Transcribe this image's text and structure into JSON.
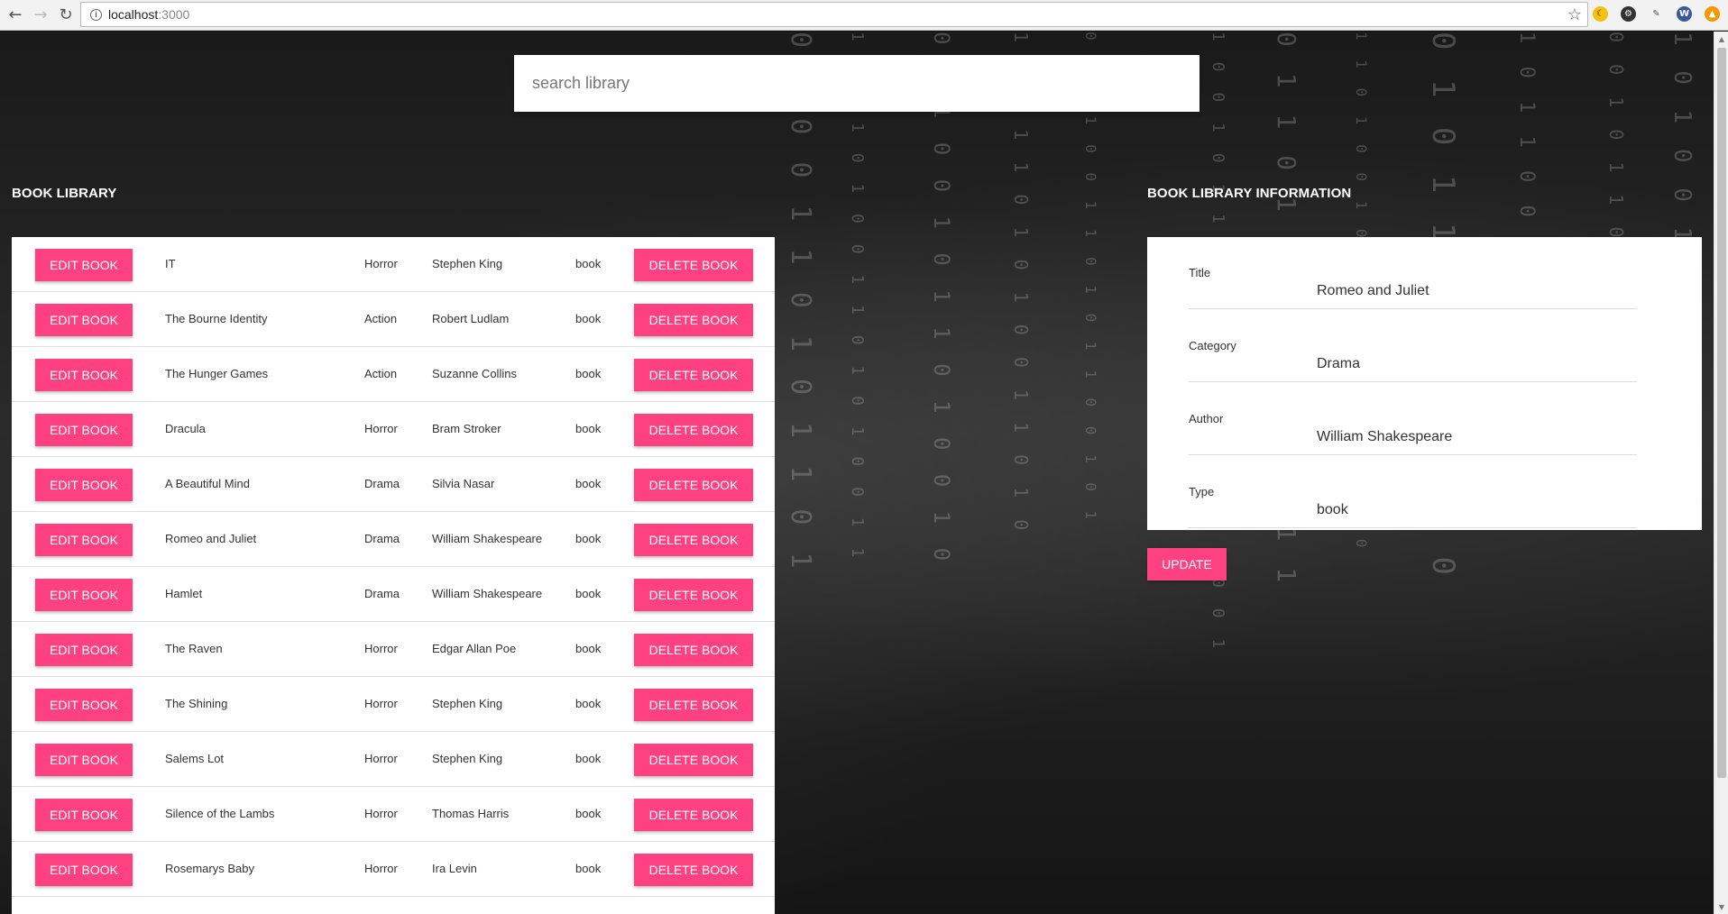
{
  "browser": {
    "url_host": "localhost",
    "url_port": ":3000"
  },
  "search": {
    "placeholder": "search library"
  },
  "library": {
    "heading": "BOOK LIBRARY",
    "edit_label": "EDIT BOOK",
    "delete_label": "DELETE BOOK",
    "books": [
      {
        "title": "IT",
        "category": "Horror",
        "author": "Stephen King",
        "type": "book"
      },
      {
        "title": "The Bourne Identity",
        "category": "Action",
        "author": "Robert Ludlam",
        "type": "book"
      },
      {
        "title": "The Hunger Games",
        "category": "Action",
        "author": "Suzanne Collins",
        "type": "book"
      },
      {
        "title": "Dracula",
        "category": "Horror",
        "author": "Bram Stroker",
        "type": "book"
      },
      {
        "title": "A Beautiful Mind",
        "category": "Drama",
        "author": "Silvia Nasar",
        "type": "book"
      },
      {
        "title": "Romeo and Juliet",
        "category": "Drama",
        "author": "William Shakespeare",
        "type": "book"
      },
      {
        "title": "Hamlet",
        "category": "Drama",
        "author": "William Shakespeare",
        "type": "book"
      },
      {
        "title": "The Raven",
        "category": "Horror",
        "author": "Edgar Allan Poe",
        "type": "book"
      },
      {
        "title": "The Shining",
        "category": "Horror",
        "author": "Stephen King",
        "type": "book"
      },
      {
        "title": "Salems Lot",
        "category": "Horror",
        "author": "Stephen King",
        "type": "book"
      },
      {
        "title": "Silence of the Lambs",
        "category": "Horror",
        "author": "Thomas Harris",
        "type": "book"
      },
      {
        "title": "Rosemarys Baby",
        "category": "Horror",
        "author": "Ira Levin",
        "type": "book"
      }
    ]
  },
  "info": {
    "heading": "BOOK LIBRARY INFORMATION",
    "fields": [
      {
        "label": "Title",
        "value": "Romeo and Juliet"
      },
      {
        "label": "Category",
        "value": "Drama"
      },
      {
        "label": "Author",
        "value": "William Shakespeare"
      },
      {
        "label": "Type",
        "value": "book"
      }
    ],
    "update_label": "UPDATE"
  },
  "colors": {
    "accent": "#ff4081",
    "background": "#1a1a1a"
  }
}
